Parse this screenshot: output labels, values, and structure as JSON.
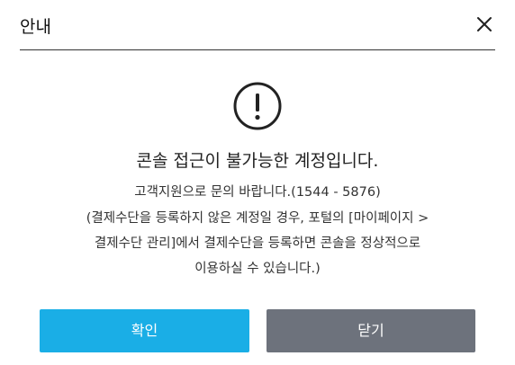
{
  "dialog": {
    "title": "안내",
    "close_icon": "close-icon",
    "alert_icon": "exclamation-circle-icon",
    "message_main": "콘솔 접근이 불가능한 계정입니다.",
    "message_sub": "고객지원으로 문의 바랍니다.(1544 - 5876)",
    "message_detail": [
      "(결제수단을 등록하지 않은 계정일 경우, 포털의 [마이페이지 >",
      "결제수단 관리]에서 결제수단을 등록하면 콘솔을 정상적으로",
      "이용하실 수 있습니다.)"
    ],
    "confirm_label": "확인",
    "close_label": "닫기"
  },
  "colors": {
    "confirm_button": "#1aaee6",
    "close_button": "#6d727c",
    "divider": "#333333"
  }
}
